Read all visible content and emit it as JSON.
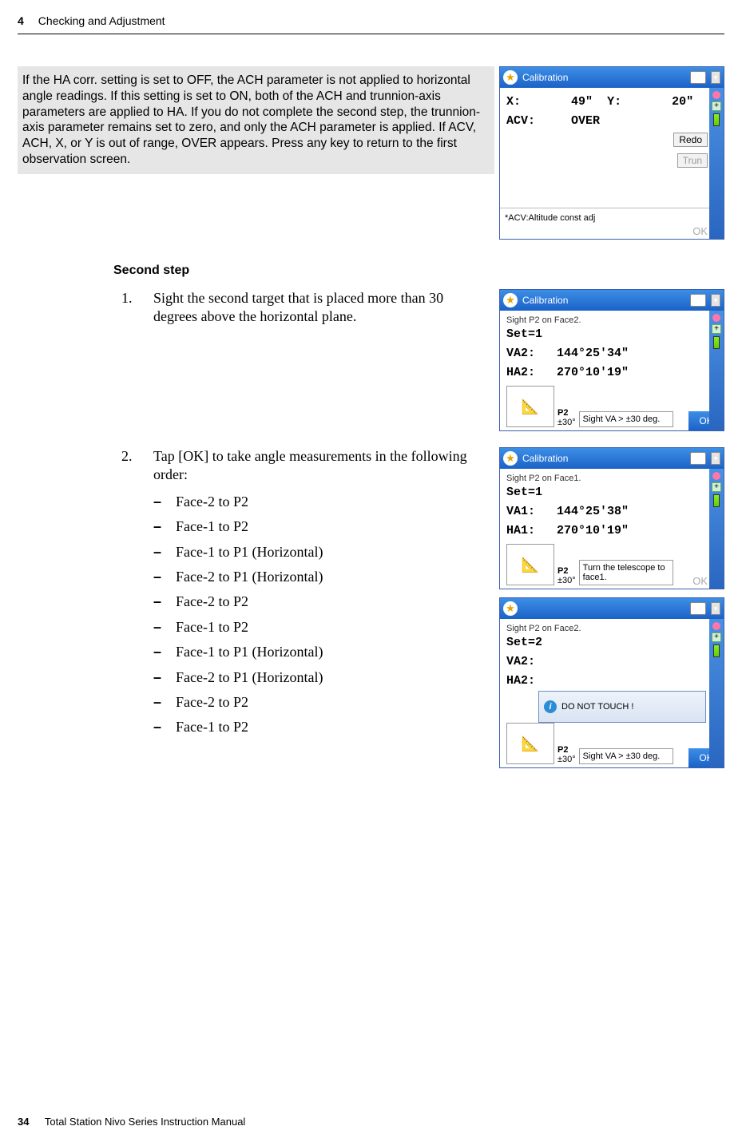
{
  "header": {
    "chapter_num": "4",
    "chapter_title": "Checking and Adjustment"
  },
  "noteText": "If the HA corr. setting is set to OFF, the ACH parameter is not applied to horizontal angle readings. If this setting is set to ON, both of the ACH and trunnion-axis parameters are applied to HA. If you do not complete the second step, the trunnion-axis parameter remains set to zero, and only the ACH parameter is applied. If ACV, ACH, X, or Y is out of range, OVER appears. Press any key to return to the first observation screen.",
  "screens": {
    "top": {
      "title": "Calibration",
      "xLabel": "X:",
      "xVal": "49\"",
      "yLabel": "Y:",
      "yVal": "20\"",
      "acvLabel": "ACV:",
      "acvVal": "OVER",
      "btnRedo": "Redo",
      "btnTrun": "Trun",
      "btnOk": "OK",
      "foot": "*ACV:Altitude const adj"
    },
    "s1": {
      "title": "Calibration",
      "line": "Sight P2 on Face2.",
      "set": "Set=1",
      "va": "VA2:",
      "vaVal": "144°25'34\"",
      "ha": "HA2:",
      "haVal": "270°10'19\"",
      "p2": "P2",
      "angle": "±30°",
      "hint": "Sight VA > ±30 deg.",
      "ok": "OK"
    },
    "s2a": {
      "title": "Calibration",
      "line": "Sight P2 on Face1.",
      "set": "Set=1",
      "va": "VA1:",
      "vaVal": "144°25'38\"",
      "ha": "HA1:",
      "haVal": "270°10'19\"",
      "p2": "P2",
      "angle": "±30°",
      "hint": "Turn the telescope to face1.",
      "ok": "OK"
    },
    "s2b": {
      "title": "",
      "line": "Sight P2 on Face2.",
      "set": "Set=2",
      "va": "VA2:",
      "ha": "HA2:",
      "msg": "DO NOT TOUCH !",
      "p2": "P2",
      "angle": "±30°",
      "hint": "Sight VA > ±30 deg.",
      "ok": "OK"
    }
  },
  "secondStep": {
    "heading": "Second step",
    "step1Num": "1.",
    "step1Text": "Sight the second target that is placed more than 30 degrees above the horizontal plane.",
    "step2Num": "2.",
    "step2Text": "Tap [OK] to take angle measurements in the following order:",
    "items": [
      "Face-2 to P2",
      "Face-1 to P2",
      "Face-1 to P1 (Horizontal)",
      "Face-2 to P1 (Horizontal)",
      "Face-2 to P2",
      "Face-1 to P2",
      "Face-1 to P1 (Horizontal)",
      "Face-2 to P1 (Horizontal)",
      "Face-2 to P2",
      "Face-1 to P2"
    ]
  },
  "footer": {
    "pageNum": "34",
    "manual": "Total Station Nivo Series Instruction Manual"
  }
}
